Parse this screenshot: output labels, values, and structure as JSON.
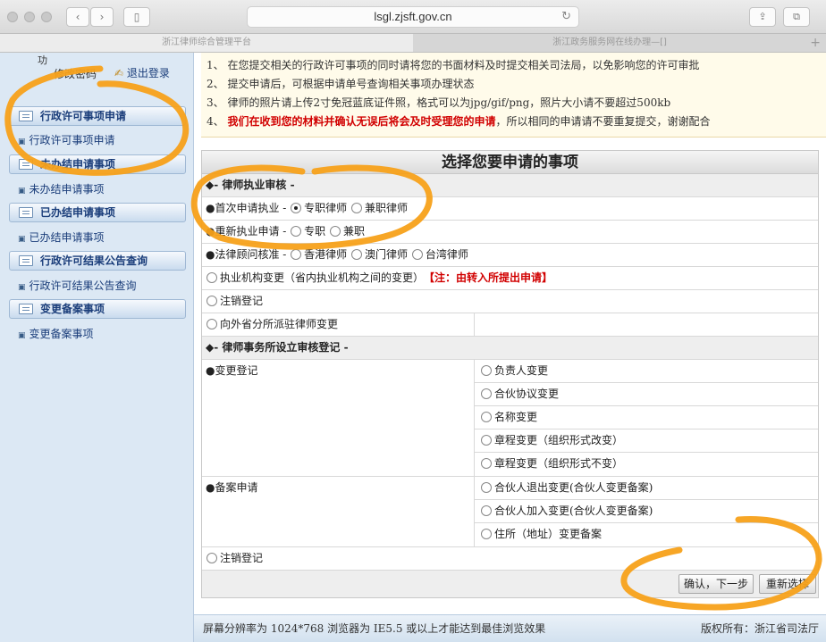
{
  "browser": {
    "url": "lsgl.zjsft.gov.cn",
    "nav_back": "‹",
    "nav_forward": "›",
    "sidebar_toggle": "▯",
    "reload": "↻",
    "share": "⇪",
    "tabs_btn": "⧉",
    "tabs": [
      {
        "label": "浙江律师综合管理平台"
      },
      {
        "label": "浙江政务服务网在线办理—[]"
      }
    ],
    "new_tab": "+"
  },
  "sidebar": {
    "cut_text": "功",
    "user_text": "修改密码",
    "logout": "退出登录",
    "logout_icon": "✍",
    "sections": [
      {
        "heading": "行政许可事项申请",
        "item": "行政许可事项申请"
      },
      {
        "heading": "未办结申请事项",
        "item": "未办结申请事项"
      },
      {
        "heading": "已办结申请事项",
        "item": "已办结申请事项"
      },
      {
        "heading": "行政许可结果公告查询",
        "item": "行政许可结果公告查询"
      },
      {
        "heading": "变更备案事项",
        "item": "变更备案事项"
      }
    ],
    "bullet": "▣"
  },
  "notice": {
    "lines": [
      "1、 在您提交相关的行政许可事项的同时请将您的书面材料及时提交相关司法局，以免影响您的许可审批",
      "2、 提交申请后，可根据申请单号查询相关事项办理状态",
      "3、 律师的照片请上传2寸免冠蓝底证件照，格式可以为jpg/gif/png，照片大小请不要超过500kb"
    ],
    "line4_prefix": "4、 ",
    "line4_red": "我们在收到您的材料并确认无误后将会及时受理您的申请",
    "line4_rest": "，所以相同的申请请不要重复提交，谢谢配合"
  },
  "form": {
    "title": "选择您要申请的事项",
    "sec1": "◆- 律师执业审核 -",
    "first_apply": "●首次申请执业 -",
    "full_time_lawyer": "专职律师",
    "part_time_lawyer": "兼职律师",
    "re_apply": "●重新执业申请 -",
    "full_time": "专职",
    "part_time": "兼职",
    "consultant": "●法律顾问核准 -",
    "hk": "香港律师",
    "macau": "澳门律师",
    "taiwan": "台湾律师",
    "org_change": "执业机构变更（省内执业机构之间的变更）",
    "org_change_note": "【注：由转入所提出申请】",
    "cancel1": "注销登记",
    "outbound": "向外省分所派驻律师变更",
    "sec2": "◆- 律师事务所设立审核登记 -",
    "change_reg": "●变更登记",
    "change_items": [
      "负责人变更",
      "合伙协议变更",
      "名称变更",
      "章程变更（组织形式改变）",
      "章程变更（组织形式不变）"
    ],
    "filing": "●备案申请",
    "filing_items": [
      "合伙人退出变更(合伙人变更备案)",
      "合伙人加入变更(合伙人变更备案)",
      "住所（地址）变更备案"
    ],
    "cancel2": "注销登记",
    "confirm": "确认，下一步",
    "reset": "重新选择"
  },
  "footer": {
    "left": "屏幕分辨率为 1024*768 浏览器为 IE5.5 或以上才能达到最佳浏览效果",
    "right": "版权所有：浙江省司法厅"
  },
  "colors": {
    "annotation": "#f7a11a",
    "alert_red": "#d10000",
    "sidebar_bg": "#dce8f4",
    "link_blue": "#1a3d7a"
  }
}
